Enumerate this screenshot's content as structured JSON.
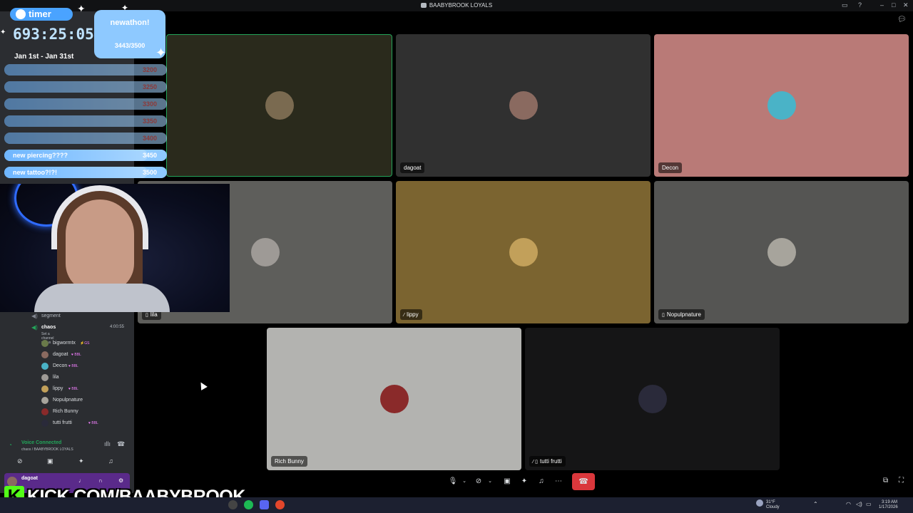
{
  "window": {
    "title": "BAABYBROOK LOYALS"
  },
  "tiles": [
    {
      "name": "",
      "bg": "#2a2a1c",
      "avatar_color": "#7a6a50",
      "speaking": true
    },
    {
      "name": "dagoat",
      "bg": "#303030",
      "avatar_color": "#8a6a60"
    },
    {
      "name": "Decon",
      "bg": "#b97a77",
      "avatar_color": "#4ab3c7"
    },
    {
      "name": "lila",
      "bg": "#5e5e5b",
      "avatar_color": "#9e9a96",
      "icon": "mobile-icon"
    },
    {
      "name": "lippy",
      "bg": "#7b6430",
      "avatar_color": "#c2a05a",
      "icon": "muted-icon"
    },
    {
      "name": "Nopulpnature",
      "bg": "#555553",
      "avatar_color": "#a7a49c",
      "icon": "mobile-icon"
    },
    {
      "name": "Rich Bunny",
      "bg": "#b3b3b0",
      "avatar_color": "#8a2a2a"
    },
    {
      "name": "tutti frutti",
      "bg": "#151516",
      "avatar_color": "#2a2a3a",
      "icon": "muted-mobile-icon"
    }
  ],
  "voice_panel": {
    "channel_segment": "segment",
    "channel": "chaos",
    "channel_time": "4:00:55",
    "channel_status": "Set a channel status",
    "members": [
      {
        "name": "bigwormtx",
        "tag": "⚡GS",
        "color": "#6a7a4a"
      },
      {
        "name": "dagoat",
        "tag": "♥ BBL",
        "color": "#8a6a60"
      },
      {
        "name": "Decon",
        "tag": "♥ BBL",
        "color": "#4ab3c7"
      },
      {
        "name": "lila",
        "tag": "",
        "color": "#9e9a96"
      },
      {
        "name": "lippy",
        "tag": "♥ BBL",
        "color": "#c2a05a"
      },
      {
        "name": "Nopulpnature",
        "tag": "",
        "color": "#a7a49c"
      },
      {
        "name": "Rich Bunny",
        "tag": "",
        "color": "#8a2a2a"
      },
      {
        "name": "tutti frutti",
        "tag": "♥ BBL",
        "color": "#2a2a3a"
      }
    ],
    "connection": "Voice Connected",
    "connection_sub": "chaos / BAABYBROOK LOYALS",
    "user": "dagoat"
  },
  "overlay": {
    "timer_label": "timer",
    "timer_value": "693:25:05",
    "date_range": "Jan 1st - Jan 31st",
    "subathon_title": "newathon!",
    "subathon_count": "3443/3500",
    "goals": [
      {
        "label": "",
        "value": "3200",
        "reached": true
      },
      {
        "label": "",
        "value": "3250",
        "reached": true
      },
      {
        "label": "",
        "value": "3300",
        "reached": true
      },
      {
        "label": "",
        "value": "3350",
        "reached": true
      },
      {
        "label": "",
        "value": "3400",
        "reached": true
      },
      {
        "label": "new piercing????",
        "value": "3450",
        "reached": false
      },
      {
        "label": "new tattoo?!?!",
        "value": "3500",
        "reached": false
      }
    ],
    "banner": "KICK.COM/BAABYBROOK"
  },
  "controls": [
    "microphone-icon",
    "chevron-down-icon",
    "camera-off-icon",
    "chevron-down-icon",
    "screen-share-icon",
    "activities-icon",
    "soundboard-icon",
    "more-icon"
  ],
  "taskbar": {
    "weather": "31°F",
    "weather_sub": "Cloudy",
    "time": "3:19 AM",
    "date": "1/17/2026"
  }
}
